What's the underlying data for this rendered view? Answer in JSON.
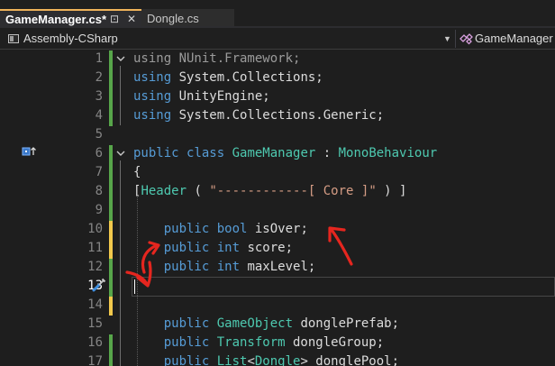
{
  "tabs": [
    {
      "label": "GameManager.cs*",
      "active": true
    },
    {
      "label": "Dongle.cs",
      "active": false
    }
  ],
  "tab_icons": {
    "pin": "pin-icon",
    "close": "close-icon",
    "pin_glyph": "⊡",
    "close_glyph": "✕"
  },
  "navbar": {
    "project": "Assembly-CSharp",
    "project_icon": "csharp-project-icon",
    "class_icon": "class-icon",
    "class_name": "GameManager",
    "dropdown_glyph": "▼"
  },
  "editor": {
    "current_line": 13,
    "line_numbers": [
      "1",
      "2",
      "3",
      "4",
      "5",
      "6",
      "7",
      "8",
      "9",
      "10",
      "11",
      "12",
      "13",
      "14",
      "15",
      "16",
      "17"
    ],
    "lines": [
      {
        "tokens": [
          {
            "t": "using ",
            "c": "dim"
          },
          {
            "t": "NUnit.Framework;",
            "c": "dim"
          }
        ]
      },
      {
        "tokens": [
          {
            "t": "using ",
            "c": "kw"
          },
          {
            "t": "System.Collections;",
            "c": "ns"
          }
        ]
      },
      {
        "tokens": [
          {
            "t": "using ",
            "c": "kw"
          },
          {
            "t": "UnityEngine;",
            "c": "ns"
          }
        ]
      },
      {
        "tokens": [
          {
            "t": "using ",
            "c": "kw"
          },
          {
            "t": "System.Collections.Generic;",
            "c": "ns"
          }
        ]
      },
      {
        "tokens": []
      },
      {
        "tokens": [
          {
            "t": "public ",
            "c": "kw"
          },
          {
            "t": "class ",
            "c": "kw"
          },
          {
            "t": "GameManager",
            "c": "cls"
          },
          {
            "t": " : ",
            "c": "punc"
          },
          {
            "t": "MonoBehaviour",
            "c": "cls"
          }
        ]
      },
      {
        "tokens": [
          {
            "t": "{",
            "c": "punc"
          }
        ]
      },
      {
        "tokens": [
          {
            "t": "[",
            "c": "punc"
          },
          {
            "t": "Header",
            "c": "cls"
          },
          {
            "t": " ( ",
            "c": "punc"
          },
          {
            "t": "\"------------[ Core ]\"",
            "c": "str"
          },
          {
            "t": " ) ]",
            "c": "punc"
          }
        ]
      },
      {
        "tokens": []
      },
      {
        "tokens": [
          {
            "t": "    public ",
            "c": "kw"
          },
          {
            "t": "bool ",
            "c": "kw"
          },
          {
            "t": "isOver;",
            "c": "ns"
          }
        ]
      },
      {
        "tokens": [
          {
            "t": "    public ",
            "c": "kw"
          },
          {
            "t": "int ",
            "c": "kw"
          },
          {
            "t": "score;",
            "c": "ns"
          }
        ]
      },
      {
        "tokens": [
          {
            "t": "    public ",
            "c": "kw"
          },
          {
            "t": "int ",
            "c": "kw"
          },
          {
            "t": "maxLevel;",
            "c": "ns"
          }
        ]
      },
      {
        "tokens": []
      },
      {
        "tokens": []
      },
      {
        "tokens": [
          {
            "t": "    public ",
            "c": "kw"
          },
          {
            "t": "GameObject",
            "c": "cls"
          },
          {
            "t": " donglePrefab;",
            "c": "ns"
          }
        ]
      },
      {
        "tokens": [
          {
            "t": "    public ",
            "c": "kw"
          },
          {
            "t": "Transform",
            "c": "cls"
          },
          {
            "t": " dongleGroup;",
            "c": "ns"
          }
        ]
      },
      {
        "tokens": [
          {
            "t": "    public ",
            "c": "kw"
          },
          {
            "t": "List",
            "c": "cls"
          },
          {
            "t": "<",
            "c": "punc"
          },
          {
            "t": "Dongle",
            "c": "cls"
          },
          {
            "t": "> donglePool;",
            "c": "ns"
          }
        ]
      }
    ],
    "gutter_icons": {
      "override": "override-arrow-icon",
      "quick_action": "screwdriver-icon"
    },
    "colors": {
      "saved": "#57a64a",
      "unsaved": "#f2c94c",
      "annotation": "#e5261f",
      "accent_tab": "#f0b35a"
    }
  },
  "annotations": [
    "red-arrow-to-isOver",
    "red-arrow-to-score",
    "red-arrow-to-caret"
  ]
}
